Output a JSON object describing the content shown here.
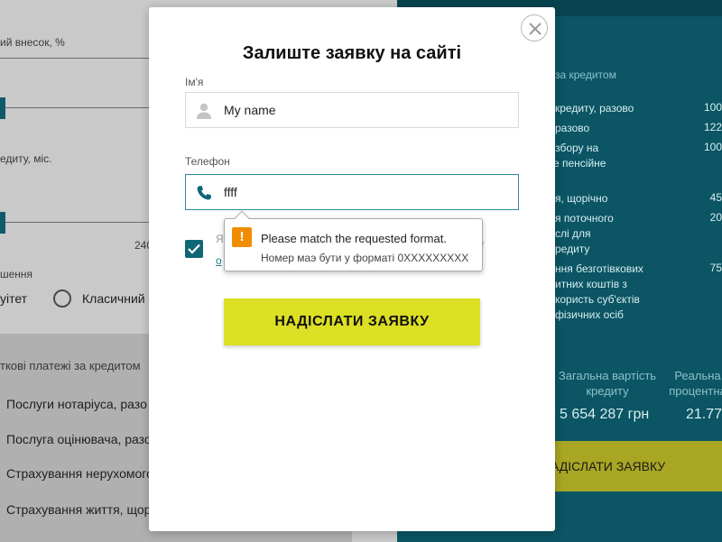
{
  "background": {
    "left": {
      "contribution_label": "ий внесок, %",
      "term_label": "едиту, міс.",
      "term_value": "240",
      "scheme_label": "шення",
      "radio_annuity_label": "уітет",
      "radio_classic_label": "Класичний",
      "payments_heading": "ткові платежі за кредитом",
      "items": [
        "Послуги нотаріуса, разо",
        "Послуга оцінювача, разо",
        "Страхування нерухомого",
        "Страхування життя, щор"
      ]
    },
    "right": {
      "heading": "за кредитом",
      "rows": [
        {
          "label": "кредиту, разово",
          "value": "100"
        },
        {
          "label": "разово",
          "value": "122"
        },
        {
          "label": "ть збору на\nвне пенсійне\nво",
          "value": "100"
        },
        {
          "label": "я, щорічно",
          "value": "45"
        },
        {
          "label": "я поточного\nслі для\nредиту",
          "value": "20"
        },
        {
          "label": "ння безготівкових\nитних коштів з\nкористь суб'єктів\nфізичних осіб",
          "value": "75"
        }
      ],
      "total_label": "Загальна вартість кредиту",
      "real_rate_label": "Реальна процентна",
      "total_value": "5 654 287 грн",
      "real_rate_value": "21.77",
      "cta_label": "АДІСЛАТИ ЗАЯВКУ"
    }
  },
  "modal": {
    "title": "Залиште заявку на сайті",
    "name_label": "Ім'я",
    "name_value": "My name",
    "phone_label": "Телефон",
    "phone_value": "ffff",
    "consent_start": "Я",
    "consent_link_a": "а",
    "consent_link_b": "о",
    "submit_label": "НАДІСЛАТИ ЗАЯВКУ"
  },
  "tooltip": {
    "title": "Please match the requested format.",
    "message": "Номер маэ бути у форматі 0XXXXXXXXX"
  },
  "colors": {
    "accent_teal": "#0e6777",
    "submit_yellow": "#dcdf23",
    "warning_orange": "#f08c00"
  }
}
